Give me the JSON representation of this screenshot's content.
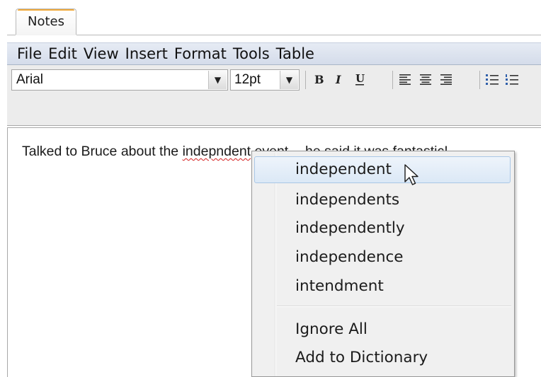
{
  "tab": {
    "label": "Notes"
  },
  "menubar": [
    "File",
    "Edit",
    "View",
    "Insert",
    "Format",
    "Tools",
    "Table"
  ],
  "toolbar": {
    "font_family": "Arial",
    "font_size": "12pt",
    "bold_icon": "bold-icon",
    "italic_icon": "italic-icon",
    "underline_icon": "underline-icon",
    "align_icons": [
      "align-left-icon",
      "align-center-icon",
      "align-right-icon"
    ],
    "list_icons": [
      "bullet-list-icon",
      "numbered-list-icon"
    ]
  },
  "editor": {
    "text_before": "Talked to Bruce about the ",
    "misspelled_word": "indepndent",
    "text_after": " event -- he said it was fantastic!"
  },
  "context_menu": {
    "suggestions": [
      "independent",
      "independents",
      "independently",
      "independence",
      "intendment"
    ],
    "actions": [
      "Ignore All",
      "Add to Dictionary"
    ],
    "highlighted_index": 0
  },
  "colors": {
    "tab_accent": "#f0a838",
    "menubar": "#dde3ee",
    "toolbar": "#ececec",
    "context_menu": "#f0f0f0",
    "highlight": "#dbe8f6",
    "spell_underline": "#d42020"
  }
}
